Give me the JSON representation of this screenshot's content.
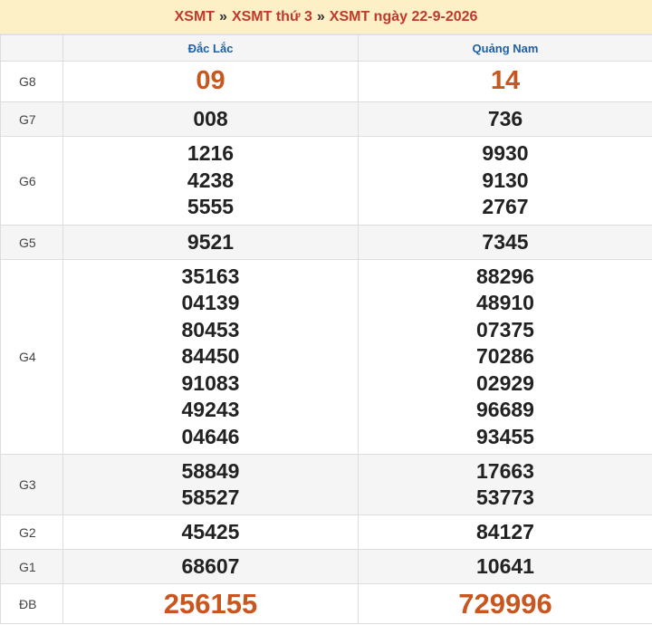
{
  "breadcrumb": {
    "crumb1": "XSMT",
    "sep": "»",
    "crumb2": "XSMT thứ 3",
    "crumb3": "XSMT ngày 22-9-2026"
  },
  "columns": [
    "",
    "Đắc Lắc",
    "Quảng Nam"
  ],
  "rows": [
    {
      "label": "G8",
      "c1": [
        "09"
      ],
      "c2": [
        "14"
      ]
    },
    {
      "label": "G7",
      "c1": [
        "008"
      ],
      "c2": [
        "736"
      ]
    },
    {
      "label": "G6",
      "c1": [
        "1216",
        "4238",
        "5555"
      ],
      "c2": [
        "9930",
        "9130",
        "2767"
      ]
    },
    {
      "label": "G5",
      "c1": [
        "9521"
      ],
      "c2": [
        "7345"
      ]
    },
    {
      "label": "G4",
      "c1": [
        "35163",
        "04139",
        "80453",
        "84450",
        "91083",
        "49243",
        "04646"
      ],
      "c2": [
        "88296",
        "48910",
        "07375",
        "70286",
        "02929",
        "96689",
        "93455"
      ]
    },
    {
      "label": "G3",
      "c1": [
        "58849",
        "58527"
      ],
      "c2": [
        "17663",
        "53773"
      ]
    },
    {
      "label": "G2",
      "c1": [
        "45425"
      ],
      "c2": [
        "84127"
      ]
    },
    {
      "label": "G1",
      "c1": [
        "68607"
      ],
      "c2": [
        "10641"
      ]
    },
    {
      "label": "ĐB",
      "c1": [
        "256155"
      ],
      "c2": [
        "729996"
      ]
    }
  ],
  "colors": {
    "accent": "#c8561e",
    "header_bg": "#fdefc6",
    "province": "#1f5fa3"
  }
}
